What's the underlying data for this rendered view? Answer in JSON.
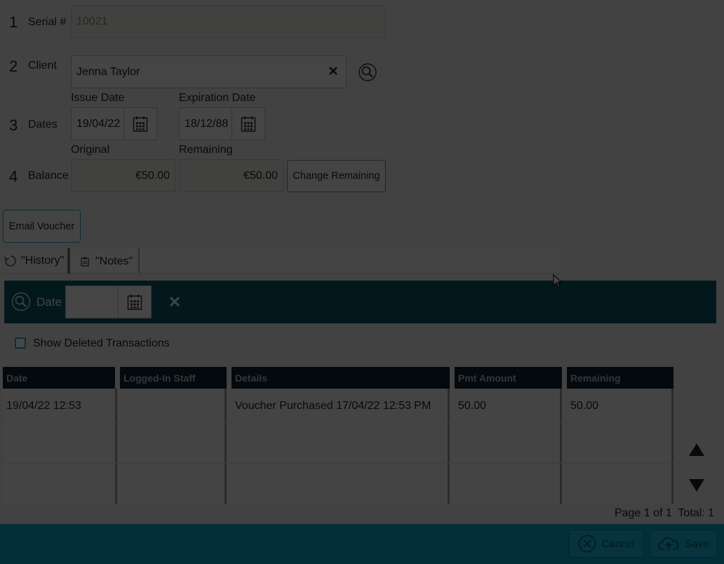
{
  "form": {
    "rows": [
      {
        "num": "1",
        "label": "Serial #"
      },
      {
        "num": "2",
        "label": "Client"
      },
      {
        "num": "3",
        "label": "Dates"
      },
      {
        "num": "4",
        "label": "Balance"
      }
    ],
    "serial_value": "10021",
    "client_value": "Jenna Taylor",
    "client_clear_icon": "close-icon",
    "client_search_icon": "search-icon",
    "issue_date_label": "Issue Date",
    "issue_date_value": "19/04/22",
    "expiration_date_label": "Expiration Date",
    "expiration_date_value": "18/12/88",
    "original_label": "Original",
    "original_value": "€50.00",
    "remaining_label": "Remaining",
    "remaining_value": "€50.00",
    "change_remaining_label": "Change Remaining",
    "email_voucher_label": "Email Voucher"
  },
  "tabs": [
    {
      "label": "\"History\"",
      "icon": "history-icon"
    },
    {
      "label": "\"Notes\"",
      "icon": "notes-icon"
    }
  ],
  "filter": {
    "date_label": "Date",
    "date_value": "",
    "search_icon": "search-icon",
    "clear_icon": "close-icon"
  },
  "show_deleted_label": "Show Deleted Transactions",
  "table": {
    "columns": [
      "Date",
      "Logged-In Staff",
      "Details",
      "Pmt Amount",
      "Remaining"
    ],
    "rows": [
      [
        "19/04/22 12:53",
        "",
        "Voucher Purchased 17/04/22 12:53 PM",
        "50.00",
        "50.00"
      ]
    ]
  },
  "pagination": "Page 1 of 1  Total: 1",
  "footer": {
    "cancel_label": "Cancel",
    "save_label": "Save"
  },
  "colors": {
    "accent": "#0fa9cf",
    "filter_bar": "#0c5864",
    "header_bg": "#0c2030",
    "overlay": "rgba(0,0,0,0.72)"
  }
}
